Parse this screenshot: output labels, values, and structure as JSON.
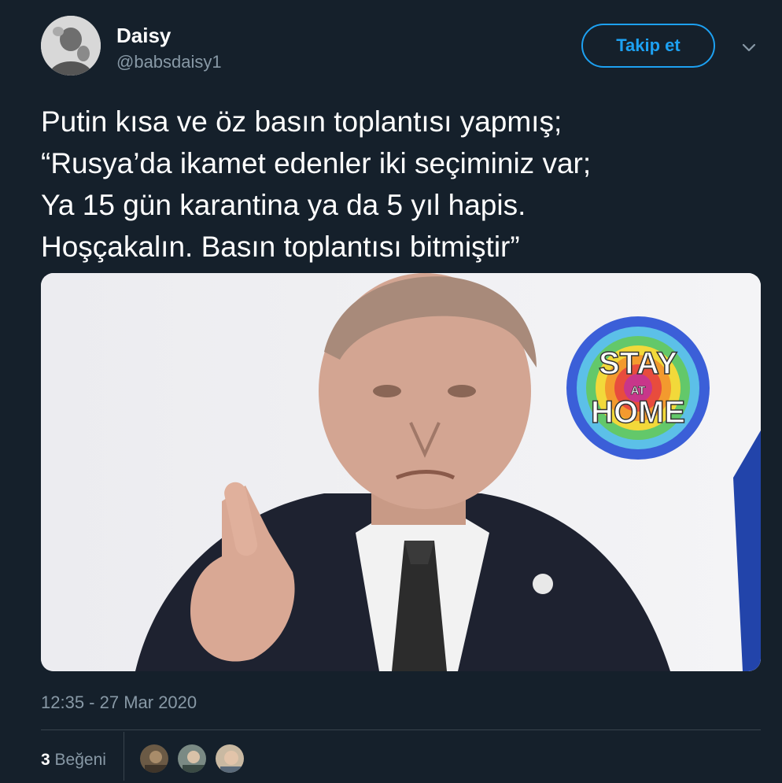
{
  "user": {
    "name": "Daisy",
    "handle": "@babsdaisy1",
    "follow_label": "Takip et"
  },
  "tweet": {
    "lines": [
      "Putin kısa ve öz basın toplantısı yapmış;",
      "“Rusya’da ikamet edenler iki seçiminiz var;",
      "Ya 15 gün karantina ya da 5 yıl hapis.",
      "Hoşçakalın. Basın toplantısı bitmiştir”"
    ],
    "timestamp": "12:35 - 27 Mar 2020"
  },
  "media": {
    "badge": {
      "top": "STAY",
      "middle": "AT",
      "bottom": "HOME"
    }
  },
  "stats": {
    "likes_count": "3",
    "likes_label": "Beğeni"
  },
  "icons": {
    "menu": "chevron-down-icon"
  },
  "colors": {
    "background": "#15202b",
    "accent": "#1da1f2",
    "muted": "#8899a6",
    "divider": "#38444d"
  }
}
